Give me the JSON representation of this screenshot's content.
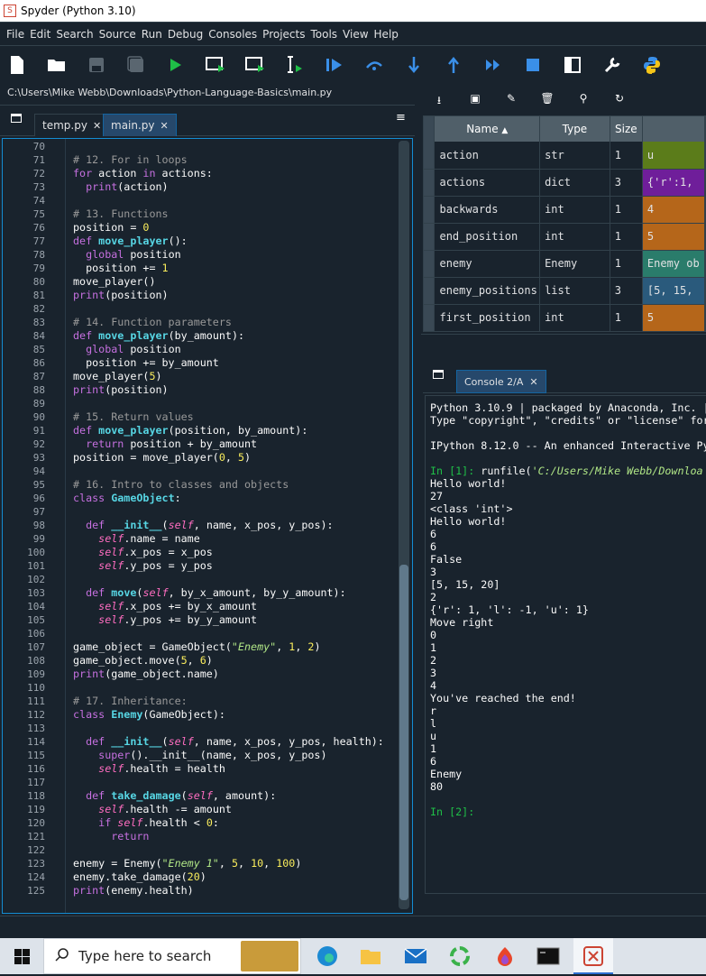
{
  "window": {
    "title": "Spyder (Python 3.10)"
  },
  "menu": [
    "File",
    "Edit",
    "Search",
    "Source",
    "Run",
    "Debug",
    "Consoles",
    "Projects",
    "Tools",
    "View",
    "Help"
  ],
  "path": "C:\\Users\\Mike Webb\\Downloads\\Python-Language-Basics\\main.py",
  "tabs": [
    {
      "label": "temp.py"
    },
    {
      "label": "main.py"
    }
  ],
  "colors": {
    "bg": "#19232d",
    "accent": "#148cd2",
    "keyword": "#c670e0",
    "func": "#57d6e4",
    "number": "#faed5c",
    "comment": "#999999",
    "string": "#b0e686",
    "self": "#ff6dc1"
  },
  "code_lines": [
    {
      "n": "70",
      "t": ""
    },
    {
      "n": "71",
      "t": "# 12. For in loops"
    },
    {
      "n": "72",
      "t": "for action in actions:"
    },
    {
      "n": "73",
      "t": "  print(action)"
    },
    {
      "n": "74",
      "t": ""
    },
    {
      "n": "75",
      "t": "# 13. Functions"
    },
    {
      "n": "76",
      "t": "position = 0"
    },
    {
      "n": "77",
      "t": "def move_player():"
    },
    {
      "n": "78",
      "t": "  global position"
    },
    {
      "n": "79",
      "t": "  position += 1"
    },
    {
      "n": "80",
      "t": "move_player()"
    },
    {
      "n": "81",
      "t": "print(position)"
    },
    {
      "n": "82",
      "t": ""
    },
    {
      "n": "83",
      "t": "# 14. Function parameters"
    },
    {
      "n": "84",
      "t": "def move_player(by_amount):"
    },
    {
      "n": "85",
      "t": "  global position"
    },
    {
      "n": "86",
      "t": "  position += by_amount"
    },
    {
      "n": "87",
      "t": "move_player(5)"
    },
    {
      "n": "88",
      "t": "print(position)"
    },
    {
      "n": "89",
      "t": ""
    },
    {
      "n": "90",
      "t": "# 15. Return values"
    },
    {
      "n": "91",
      "t": "def move_player(position, by_amount):"
    },
    {
      "n": "92",
      "t": "  return position + by_amount"
    },
    {
      "n": "93",
      "t": "position = move_player(0, 5)"
    },
    {
      "n": "94",
      "t": ""
    },
    {
      "n": "95",
      "t": "# 16. Intro to classes and objects"
    },
    {
      "n": "96",
      "t": "class GameObject:"
    },
    {
      "n": "97",
      "t": ""
    },
    {
      "n": "98",
      "t": "  def __init__(self, name, x_pos, y_pos):"
    },
    {
      "n": "99",
      "t": "    self.name = name"
    },
    {
      "n": "100",
      "t": "    self.x_pos = x_pos"
    },
    {
      "n": "101",
      "t": "    self.y_pos = y_pos"
    },
    {
      "n": "102",
      "t": ""
    },
    {
      "n": "103",
      "t": "  def move(self, by_x_amount, by_y_amount):"
    },
    {
      "n": "104",
      "t": "    self.x_pos += by_x_amount"
    },
    {
      "n": "105",
      "t": "    self.y_pos += by_y_amount"
    },
    {
      "n": "106",
      "t": ""
    },
    {
      "n": "107",
      "t": "game_object = GameObject(\"Enemy\", 1, 2)"
    },
    {
      "n": "108",
      "t": "game_object.move(5, 6)"
    },
    {
      "n": "109",
      "t": "print(game_object.name)"
    },
    {
      "n": "110",
      "t": ""
    },
    {
      "n": "111",
      "t": "# 17. Inheritance:"
    },
    {
      "n": "112",
      "t": "class Enemy(GameObject):"
    },
    {
      "n": "113",
      "t": ""
    },
    {
      "n": "114",
      "t": "  def __init__(self, name, x_pos, y_pos, health):"
    },
    {
      "n": "115",
      "t": "    super().__init__(name, x_pos, y_pos)"
    },
    {
      "n": "116",
      "t": "    self.health = health"
    },
    {
      "n": "117",
      "t": ""
    },
    {
      "n": "118",
      "t": "  def take_damage(self, amount):"
    },
    {
      "n": "119",
      "t": "    self.health -= amount"
    },
    {
      "n": "120",
      "t": "    if self.health < 0:"
    },
    {
      "n": "121",
      "t": "      return"
    },
    {
      "n": "122",
      "t": ""
    },
    {
      "n": "123",
      "t": "enemy = Enemy(\"Enemy 1\", 5, 10, 100)"
    },
    {
      "n": "124",
      "t": "enemy.take_damage(20)"
    },
    {
      "n": "125",
      "t": "print(enemy.health)"
    }
  ],
  "variable_explorer": {
    "headers": [
      "Name",
      "Type",
      "Size"
    ],
    "rows": [
      {
        "name": "action",
        "type": "str",
        "size": "1",
        "value": "u",
        "color": "#5b7c1a"
      },
      {
        "name": "actions",
        "type": "dict",
        "size": "3",
        "value": "{'r':1,",
        "color": "#6f1e9a"
      },
      {
        "name": "backwards",
        "type": "int",
        "size": "1",
        "value": "4",
        "color": "#b5661a"
      },
      {
        "name": "end_position",
        "type": "int",
        "size": "1",
        "value": "5",
        "color": "#b5661a"
      },
      {
        "name": "enemy",
        "type": "Enemy",
        "size": "1",
        "value": "Enemy ob",
        "color": "#2a7c6b"
      },
      {
        "name": "enemy_positions",
        "type": "list",
        "size": "3",
        "value": "[5, 15,",
        "color": "#2a5a7c"
      },
      {
        "name": "first_position",
        "type": "int",
        "size": "1",
        "value": "5",
        "color": "#b5661a"
      }
    ]
  },
  "console": {
    "tab": "Console 2/A",
    "lines": [
      "Python 3.10.9 | packaged by Anaconda, Inc. |",
      "Type \"copyright\", \"credits\" or \"license\" for",
      "",
      "IPython 8.12.0 -- An enhanced Interactive Py",
      "",
      "In [1]: runfile('C:/Users/Mike Webb/Downloa",
      "Hello world!",
      "27",
      "<class 'int'>",
      "Hello world!",
      "6",
      "6",
      "False",
      "3",
      "[5, 15, 20]",
      "2",
      "{'r': 1, 'l': -1, 'u': 1}",
      "Move right",
      "0",
      "1",
      "2",
      "3",
      "4",
      "You've reached the end!",
      "r",
      "l",
      "u",
      "1",
      "6",
      "Enemy",
      "80",
      "",
      "In [2]:"
    ]
  },
  "taskbar": {
    "search_placeholder": "Type here to search"
  }
}
